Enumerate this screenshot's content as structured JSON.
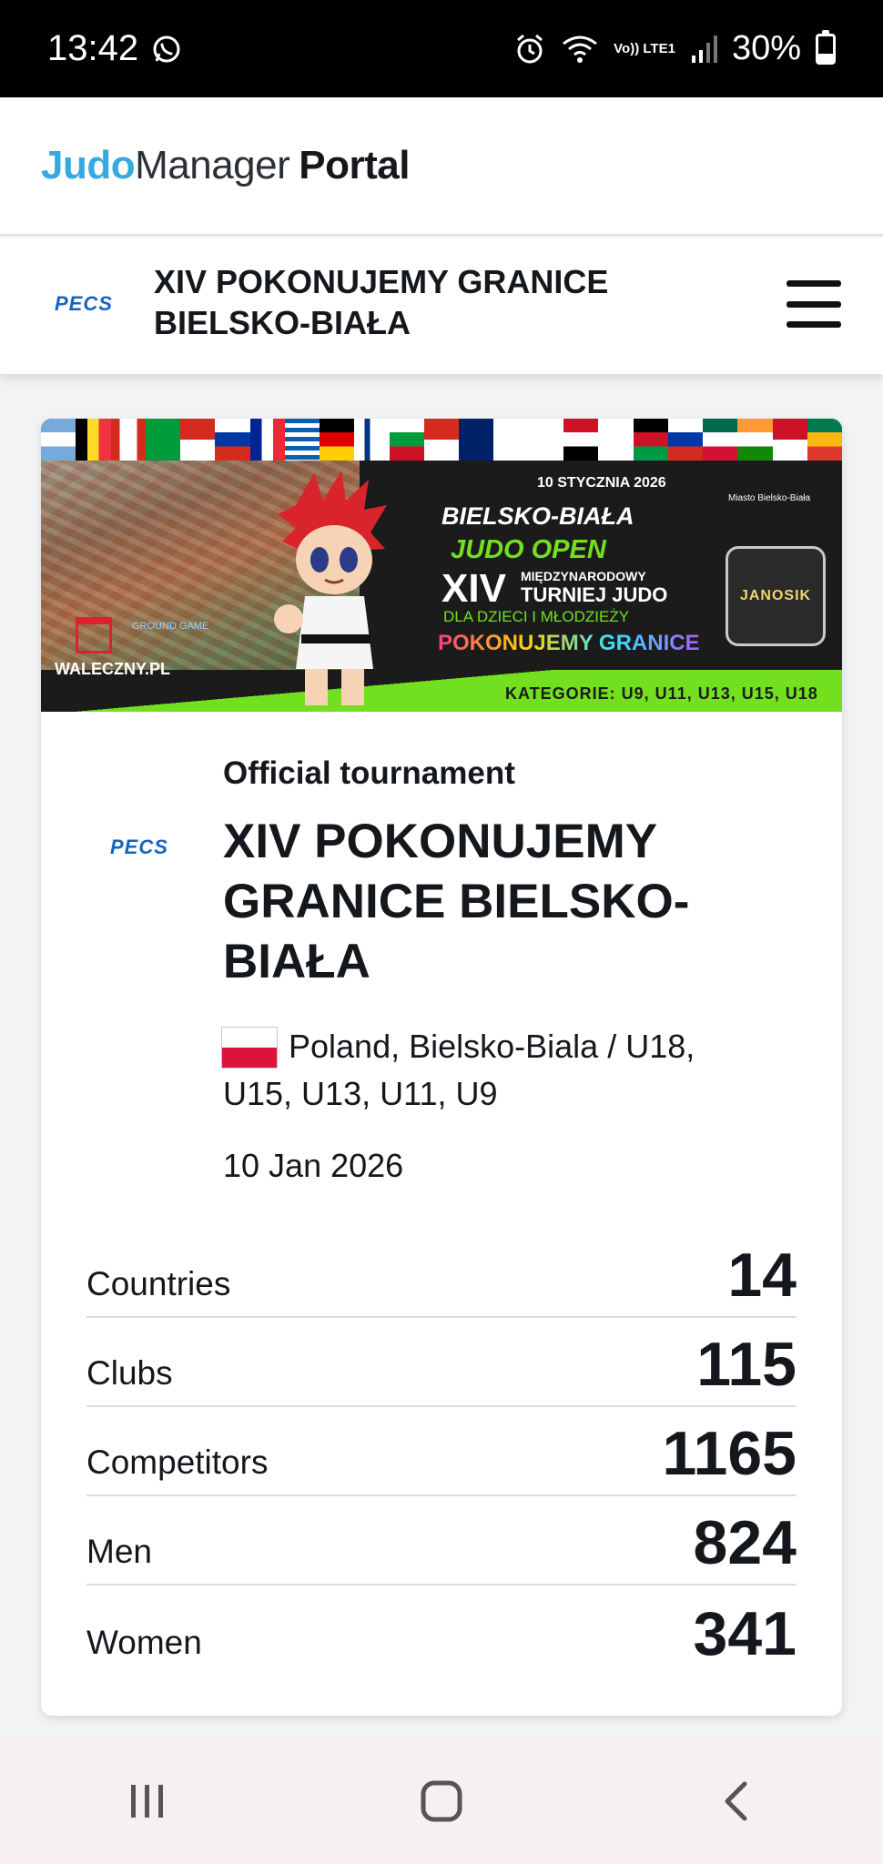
{
  "status_bar": {
    "time": "13:42",
    "battery": "30%",
    "network_label": "Vo)) LTE1",
    "icons": [
      "whatsapp-icon",
      "alarm-icon",
      "wifi-icon",
      "signal-icon",
      "battery-icon"
    ]
  },
  "portal": {
    "logo_part1": "Judo",
    "logo_part2": "Manager",
    "logo_part3": "Portal",
    "brand_color": "#36a9e1"
  },
  "tournament_header": {
    "org_logo": "PECS",
    "title": "XIV POKONUJEMY GRANICE BIELSKO-BIAŁA",
    "menu_icon": "hamburger-menu-icon"
  },
  "banner": {
    "date": "10 STYCZNIA 2026",
    "line1": "BIELSKO-BIAŁA",
    "line2": "JUDO OPEN",
    "line3_roman": "XIV",
    "line3_small": "MIĘDZYNARODOWY",
    "line3_big": "TURNIEJ JUDO",
    "line4": "DLA DZIECI I MŁODZIEŻY",
    "line5": "POKONUJEMY GRANICE",
    "categories": "KATEGORIE: U9, U11, U13, U15, U18",
    "sponsor": "WALECZNY.PL",
    "club_logo": "JANOSIK",
    "partner_logo": "GROUND GAME",
    "city_crest": "Miasto Bielsko-Biała",
    "accent_color": "#72e01e"
  },
  "card": {
    "org_logo": "PECS",
    "type": "Official tournament",
    "title": "XIV POKONUJEMY GRANICE BIELSKO-BIAŁA",
    "location": "Poland, Bielsko-Biala  /  U18, U15, U13, U11, U9",
    "date": "10 Jan 2026",
    "flag_colors": [
      "#ffffff",
      "#dc143c"
    ]
  },
  "stats": [
    {
      "label": "Countries",
      "value": "14"
    },
    {
      "label": "Clubs",
      "value": "115"
    },
    {
      "label": "Competitors",
      "value": "1165"
    },
    {
      "label": "Men",
      "value": "824"
    },
    {
      "label": "Women",
      "value": "341"
    }
  ],
  "nav_bar": {
    "buttons": [
      "recents-icon",
      "home-icon",
      "back-icon"
    ]
  }
}
